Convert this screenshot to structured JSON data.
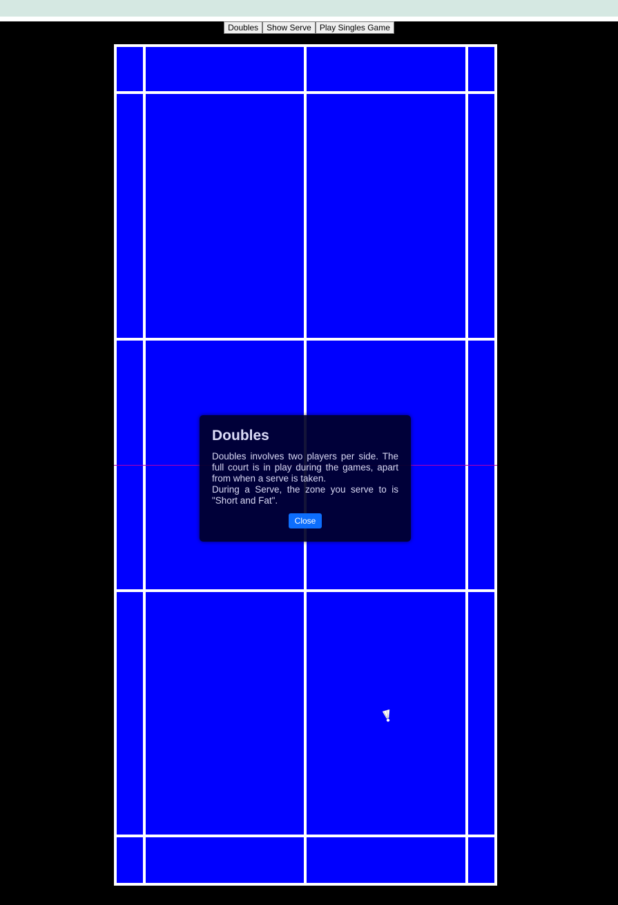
{
  "toolbar": {
    "doubles_label": "Doubles",
    "show_serve_label": "Show Serve",
    "play_singles_label": "Play Singles Game"
  },
  "court": {
    "surface_color": "#0000ff",
    "line_color": "#ffffff",
    "net_color": "#b000b0",
    "background_color": "#000000"
  },
  "modal": {
    "title": "Doubles",
    "paragraph_1": "Doubles involves two players per side. The full court is in play during the games, apart from when a serve is taken.",
    "paragraph_2": "During a Serve, the zone you serve to is \"Short and Fat\".",
    "close_label": "Close",
    "close_color": "#0d6efd"
  },
  "icons": {
    "shuttlecock": "shuttlecock-icon"
  }
}
